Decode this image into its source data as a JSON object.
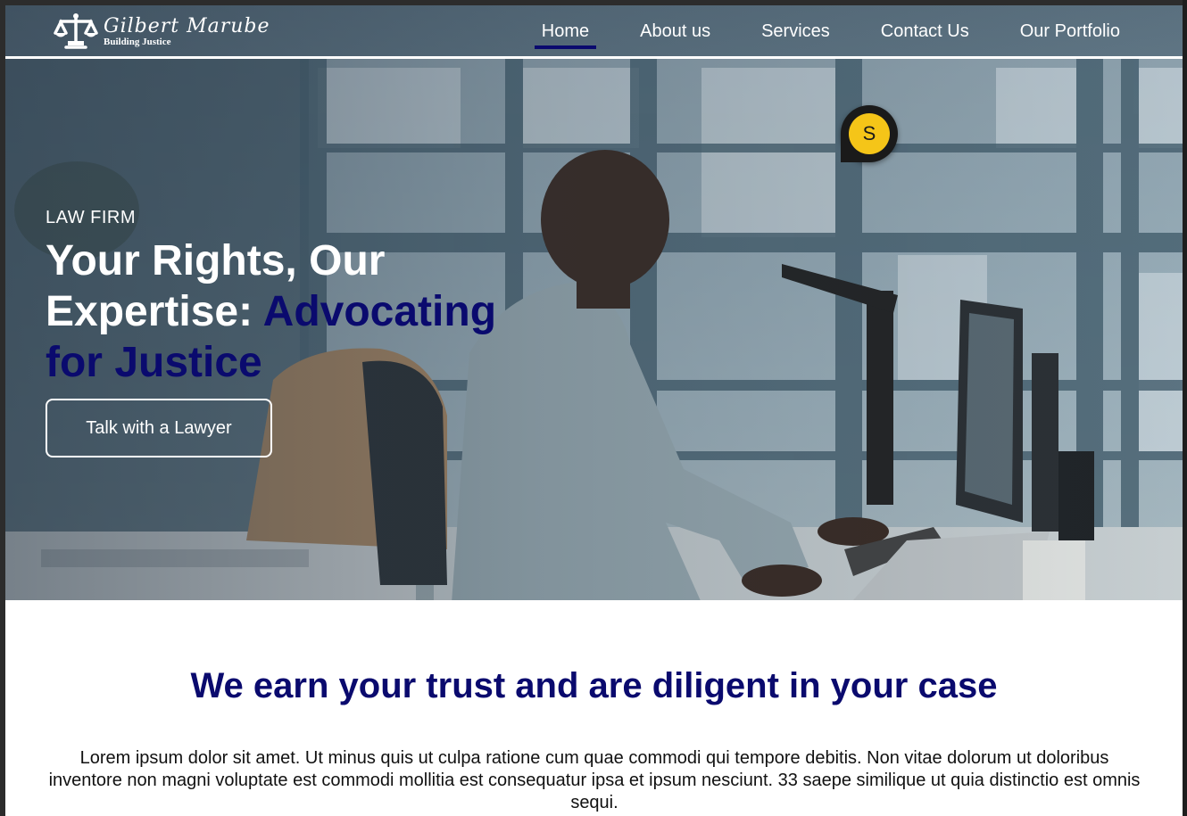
{
  "brand": {
    "name": "Gilbert Marube",
    "tagline": "Building Justice"
  },
  "nav": {
    "items": [
      {
        "label": "Home",
        "active": true
      },
      {
        "label": "About us",
        "active": false
      },
      {
        "label": "Services",
        "active": false
      },
      {
        "label": "Contact Us",
        "active": false
      },
      {
        "label": "Our Portfolio",
        "active": false
      }
    ]
  },
  "chat": {
    "initial": "S",
    "color": "#f5c518"
  },
  "hero": {
    "eyebrow": "LAW FIRM",
    "headline_white": "Your Rights, Our Expertise: ",
    "headline_accent": "Advocating for Justice",
    "cta_label": "Talk with a Lawyer"
  },
  "section": {
    "title": "We earn your trust and are diligent in your case",
    "body": "Lorem ipsum dolor sit amet. Ut minus quis ut culpa ratione cum quae commodi qui tempore debitis. Non vitae dolorum ut doloribus inventore non magni voluptate est commodi mollitia est consequatur ipsa et ipsum nesciunt. 33 saepe similique ut quia distinctio est omnis sequi."
  },
  "colors": {
    "accent": "#0a0a6e",
    "text_light": "#ffffff"
  }
}
